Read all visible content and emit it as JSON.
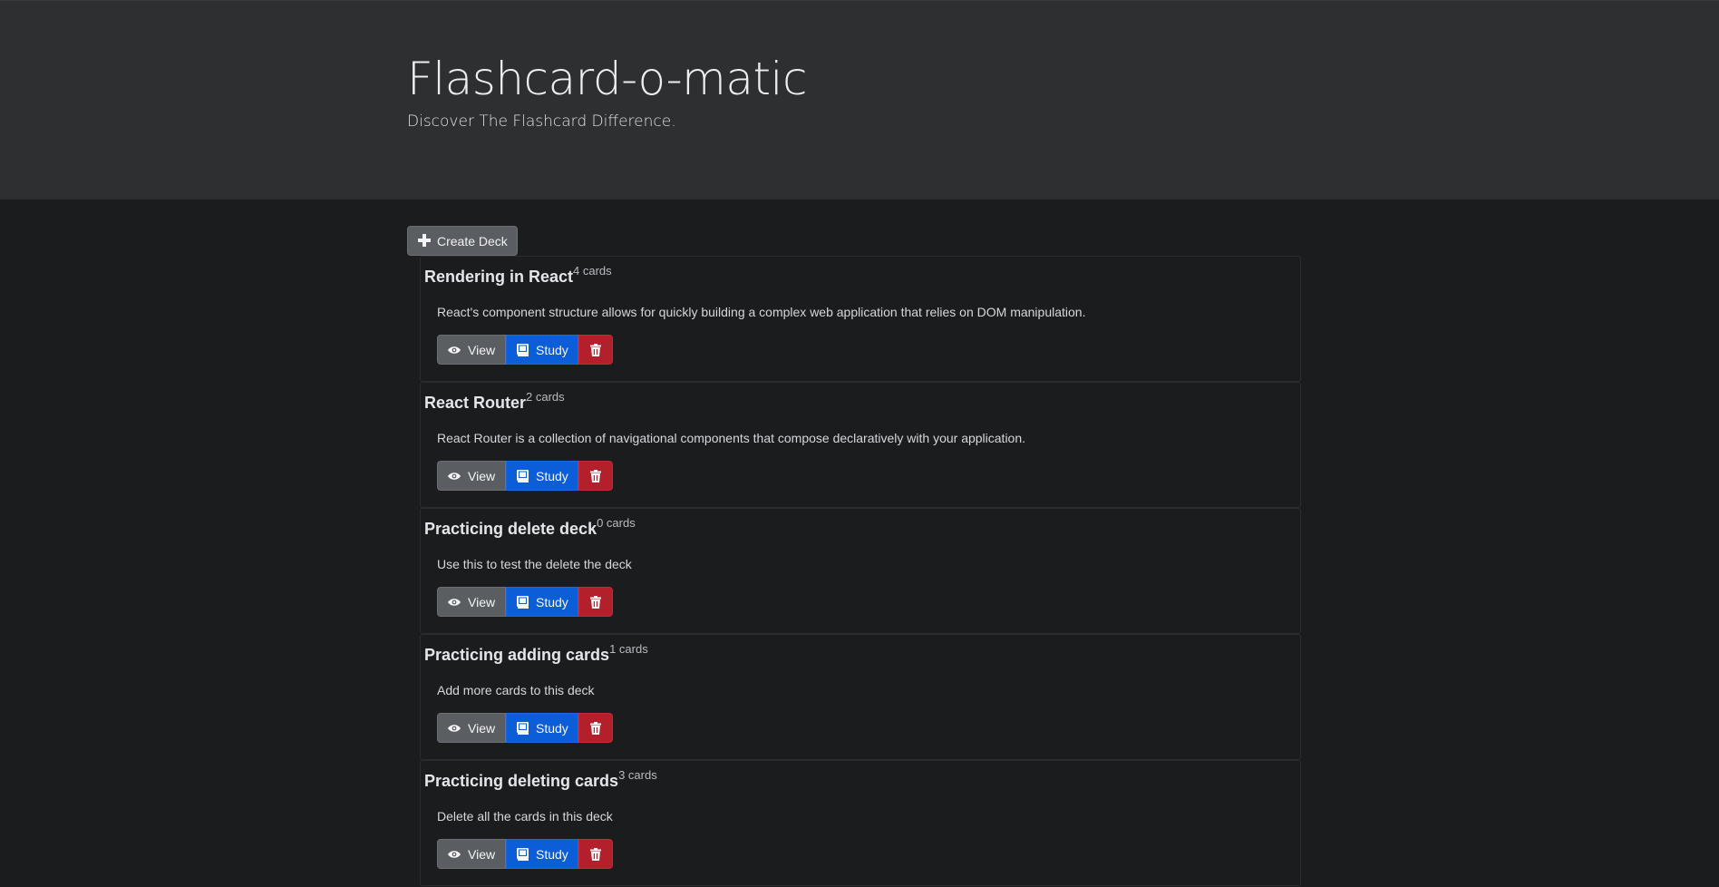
{
  "header": {
    "title": "Flashcard-o-matic",
    "subtitle": "Discover The Flashcard Difference."
  },
  "toolbar": {
    "create_label": "Create Deck",
    "create_icon": "plus-icon"
  },
  "deck_buttons": {
    "view_label": "View",
    "study_label": "Study",
    "view_icon": "eye-icon",
    "study_icon": "book-icon",
    "delete_icon": "trash-icon"
  },
  "decks": [
    {
      "name": "Rendering in React",
      "count": "4 cards",
      "description": "React's component structure allows for quickly building a complex web application that relies on DOM manipulation."
    },
    {
      "name": "React Router",
      "count": "2 cards",
      "description": "React Router is a collection of navigational components that compose declaratively with your application."
    },
    {
      "name": "Practicing delete deck",
      "count": "0 cards",
      "description": "Use this to test the delete the deck"
    },
    {
      "name": "Practicing adding cards",
      "count": "1 cards",
      "description": "Add more cards to this deck"
    },
    {
      "name": "Practicing deleting cards",
      "count": "3 cards",
      "description": "Delete all the cards in this deck"
    }
  ],
  "colors": {
    "page_bg": "#1b1c1e",
    "header_bg": "#2e2f31",
    "secondary": "#5a5d61",
    "primary": "#0b5ed7",
    "danger": "#b3202b"
  }
}
